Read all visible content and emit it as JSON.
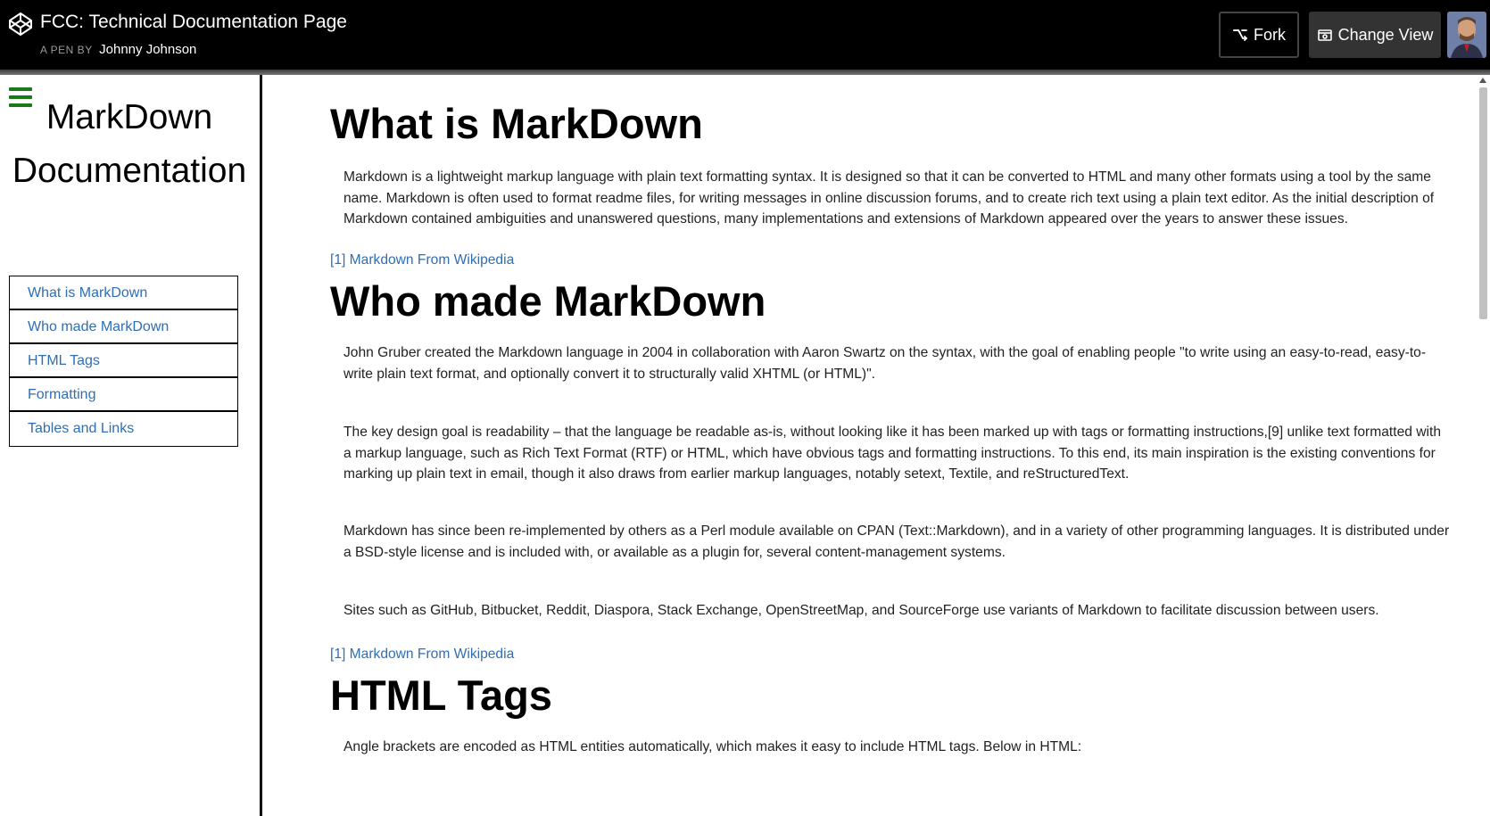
{
  "header": {
    "title": "FCC: Technical Documentation Page",
    "pen_by": "A PEN BY",
    "author": "Johnny Johnson",
    "fork_label": "Fork",
    "change_view_label": "Change View",
    "logo_icon": "codepen-logo-icon"
  },
  "sidebar": {
    "title_line1": "MarkDown",
    "title_line2": "Documentation",
    "menu_icon": "hamburger-menu-icon",
    "items": [
      {
        "label": "What is MarkDown"
      },
      {
        "label": "Who made MarkDown"
      },
      {
        "label": "HTML Tags"
      },
      {
        "label": "Formatting"
      },
      {
        "label": "Tables and Links"
      }
    ]
  },
  "main": {
    "sections": [
      {
        "title": "What is MarkDown",
        "paragraphs": [
          "Markdown is a lightweight markup language with plain text formatting syntax. It is designed so that it can be converted to HTML and many other formats using a tool by the same name. Markdown is often used to format readme files, for writing messages in online discussion forums, and to create rich text using a plain text editor. As the initial description of Markdown contained ambiguities and unanswered questions, many implementations and extensions of Markdown appeared over the years to answer these issues."
        ],
        "ref": "[1] Markdown From Wikipedia"
      },
      {
        "title": "Who made MarkDown",
        "paragraphs": [
          "John Gruber created the Markdown language in 2004 in collaboration with Aaron Swartz on the syntax, with the goal of enabling people \"to write using an easy-to-read, easy-to-write plain text format, and optionally convert it to structurally valid XHTML (or HTML)\".",
          "The key design goal is readability – that the language be readable as-is, without looking like it has been marked up with tags or formatting instructions,[9] unlike text formatted with a markup language, such as Rich Text Format (RTF) or HTML, which have obvious tags and formatting instructions. To this end, its main inspiration is the existing conventions for marking up plain text in email, though it also draws from earlier markup languages, notably setext, Textile, and reStructuredText.",
          "Markdown has since been re-implemented by others as a Perl module available on CPAN (Text::Markdown), and in a variety of other programming languages. It is distributed under a BSD-style license and is included with, or available as a plugin for, several content-management systems.",
          "Sites such as GitHub, Bitbucket, Reddit, Diaspora, Stack Exchange, OpenStreetMap, and SourceForge use variants of Markdown to facilitate discussion between users."
        ],
        "ref": "[1] Markdown From Wikipedia"
      },
      {
        "title": "HTML Tags",
        "paragraphs": [
          "Angle brackets are encoded as HTML entities automatically, which makes it easy to include HTML tags. Below in HTML:"
        ]
      }
    ]
  },
  "colors": {
    "link": "#2f6eb4",
    "menu_icon": "#1a7a1a",
    "topbar": "#000000"
  }
}
